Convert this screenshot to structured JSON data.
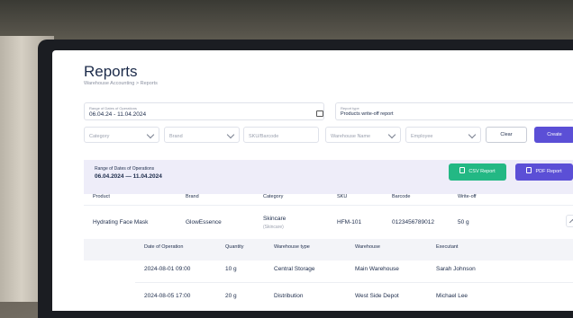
{
  "page": {
    "title": "Reports",
    "breadcrumb": "Warehouse Accounting  >  Reports"
  },
  "filters": {
    "date_range_label": "Range of Dates of Operations",
    "date_range_value": "06.04.24 - 11.04.2024",
    "report_type_label": "Report type",
    "report_type_value": "Products write-off report",
    "category_placeholder": "Category",
    "brand_placeholder": "Brand",
    "sku_placeholder": "SKU/Barcode",
    "warehouse_placeholder": "Warehouse Name",
    "employee_placeholder": "Employee",
    "clear_label": "Clear",
    "create_label": "Create"
  },
  "summary": {
    "range_label": "Range of Dates of Operations",
    "range_value": "06.04.2024 — 11.04.2024",
    "csv_label": "CSV Report",
    "pdf_label": "PDF Report"
  },
  "table": {
    "headers": [
      "Product",
      "Brand",
      "Category",
      "SKU",
      "Barcode",
      "Write-off"
    ],
    "row": {
      "product": "Hydrating Face Mask",
      "brand": "GlowEssence",
      "category": "Skincare",
      "category_sub": "(Skincare)",
      "sku": "HFM-101",
      "barcode": "0123456789012",
      "writeoff": "50 g"
    },
    "sub_headers": [
      "Date of Operation",
      "Quantity",
      "Warehouse type",
      "Warehouse",
      "Executant"
    ],
    "sub_rows": [
      {
        "date": "2024-08-01 09:00",
        "qty": "10 g",
        "type": "Central Storage",
        "warehouse": "Main Warehouse",
        "executant": "Sarah Johnson"
      },
      {
        "date": "2024-08-05 17:00",
        "qty": "20 g",
        "type": "Distribution",
        "warehouse": "West Side Depot",
        "executant": "Michael Lee"
      }
    ]
  },
  "colors": {
    "accent": "#5b4fd6",
    "csv": "#23b884",
    "panel": "#eeedf9",
    "title": "#1c2b4a"
  }
}
